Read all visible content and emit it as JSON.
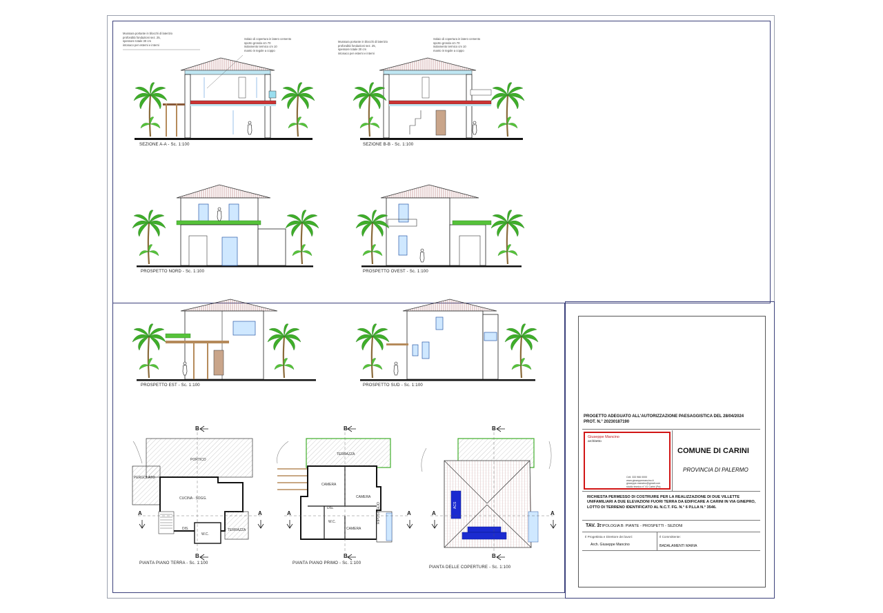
{
  "drawing_captions": {
    "sez_aa": "SEZIONE A-A - Sc. 1:100",
    "sez_bb": "SEZIONE B-B - Sc. 1:100",
    "nord": "PROSPETTO NORD - Sc. 1:100",
    "ovest": "PROSPETTO OVEST - Sc. 1:100",
    "est": "PROSPETTO EST - Sc. 1:100",
    "sud": "PROSPETTO SUD - Sc. 1:100",
    "pt": "PIANTA PIANO TERRA - Sc. 1:100",
    "p1": "PIANTA PIANO PRIMO - Sc. 1:100",
    "cop": "PIANTA DELLE COPERTURE - Sc. 1:100"
  },
  "section_notes": {
    "a_left": "Muratura portante in blocchi di laterizio\nprofondità fondazioni sez. 25,\nspessore totale 30 cm\nintonaco per esterni e interni",
    "a_right": "Solaio di copertura in latero cemento\nsporto gronda cm 70\nisolamento termico cm 10\nmanto in tegole a coppo",
    "b_left": "Muratura portante in blocchi di laterizio\nprofondità fondazioni sez. 25,\nspessore totale 30 cm\nintonaco per esterni e interni",
    "b_right": "Solaio di copertura in latero cemento\nsporto gronda cm 70\nisolamento termico cm 10\nmanto in tegole a coppo"
  },
  "plan_labels": {
    "portico": "PORTICO",
    "pergolato": "PERGOLATO",
    "cucina": "CUCINA - SOGG.",
    "wc": "W.C.",
    "dis": "DIS.",
    "terrazza_pt": "TERRAZZA",
    "terrazza_p1": "TERRAZZA",
    "camera1": "CAMERA",
    "camera2": "CAMERA",
    "camera3": "CAMERA",
    "dis_p1": "DIS.",
    "wc_p1": "W.C.",
    "ripostiglio": "RIPOSTIGLIO",
    "acs": "ACS",
    "marker_a": "A",
    "marker_b": "B"
  },
  "title_block": {
    "project_line1": "PROGETTO ADEGUATO ALL'AUTORIZZAZIONE PAESAGGISTICA DEL 28/04/2024",
    "project_line2": "PROT. N.° 20230187190",
    "architect_name": "Giuseppe Mancino",
    "architect_role": "architetto",
    "architect_contact": "Cell. 333 966 0000\nwww.giuseppemancino.it\ngiuseppe.mancino@gmail.com\nstudio tecnico n° 41 Carini (Pa)",
    "comune": "COMUNE DI CARINI",
    "provincia": "PROVINCIA DI PALERMO",
    "request": "RICHIESTA PERMESSO DI COSTRUIRE PER LA REALIZZAZIONE DI DUE VILLETTE UNIFAMILIARI A DUE ELEVAZIONI FUORI TERRA DA EDIFICARE A CARINI IN VIA GINEPRO, LOTTO DI TERRENO IDENTIFICATO AL N.C.T. FG. N.° 6 P.LLA N.° 3546.",
    "tav_number": "TAV. 3:",
    "tav_description": "TIPOLOGIA B: PIANTE - PROSPETTI - SEZIONI",
    "progettista_label": "Il Progettista e Direttore dei lavori:",
    "progettista_value": "Arch. Giuseppe Mancino",
    "committente_label": "Il Committente:",
    "committente_value": "BADALAMENTI MARIA"
  },
  "colors": {
    "frame": "#3a3f7a",
    "logo_border": "#d11414",
    "logo_blue": "#2a6fd6",
    "logo_green": "#2a9a3a",
    "logo_orange": "#ee7a1c",
    "solar_panel": "#1b2bd0",
    "palm_green": "#3fae2a"
  }
}
